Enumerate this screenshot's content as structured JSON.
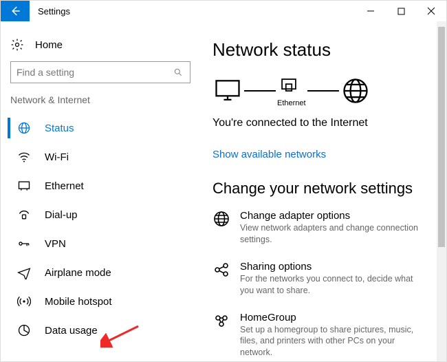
{
  "titlebar": {
    "title": "Settings"
  },
  "sidebar": {
    "home": "Home",
    "search_placeholder": "Find a setting",
    "category": "Network & Internet",
    "items": [
      {
        "label": "Status",
        "icon": "status-icon"
      },
      {
        "label": "Wi-Fi",
        "icon": "wifi-icon"
      },
      {
        "label": "Ethernet",
        "icon": "ethernet-icon"
      },
      {
        "label": "Dial-up",
        "icon": "dialup-icon"
      },
      {
        "label": "VPN",
        "icon": "vpn-icon"
      },
      {
        "label": "Airplane mode",
        "icon": "airplane-icon"
      },
      {
        "label": "Mobile hotspot",
        "icon": "hotspot-icon"
      },
      {
        "label": "Data usage",
        "icon": "datausage-icon"
      }
    ]
  },
  "content": {
    "heading": "Network status",
    "diagram_label": "Ethernet",
    "connected_text": "You're connected to the Internet",
    "available_link": "Show available networks",
    "change_heading": "Change your network settings",
    "settings": [
      {
        "title": "Change adapter options",
        "desc": "View network adapters and change connection settings."
      },
      {
        "title": "Sharing options",
        "desc": "For the networks you connect to, decide what you want to share."
      },
      {
        "title": "HomeGroup",
        "desc": "Set up a homegroup to share pictures, music, files, and printers with other PCs on your network."
      }
    ]
  },
  "colors": {
    "accent": "#0078d7",
    "link": "#0a6fcf",
    "arrow": "#ef2828"
  }
}
